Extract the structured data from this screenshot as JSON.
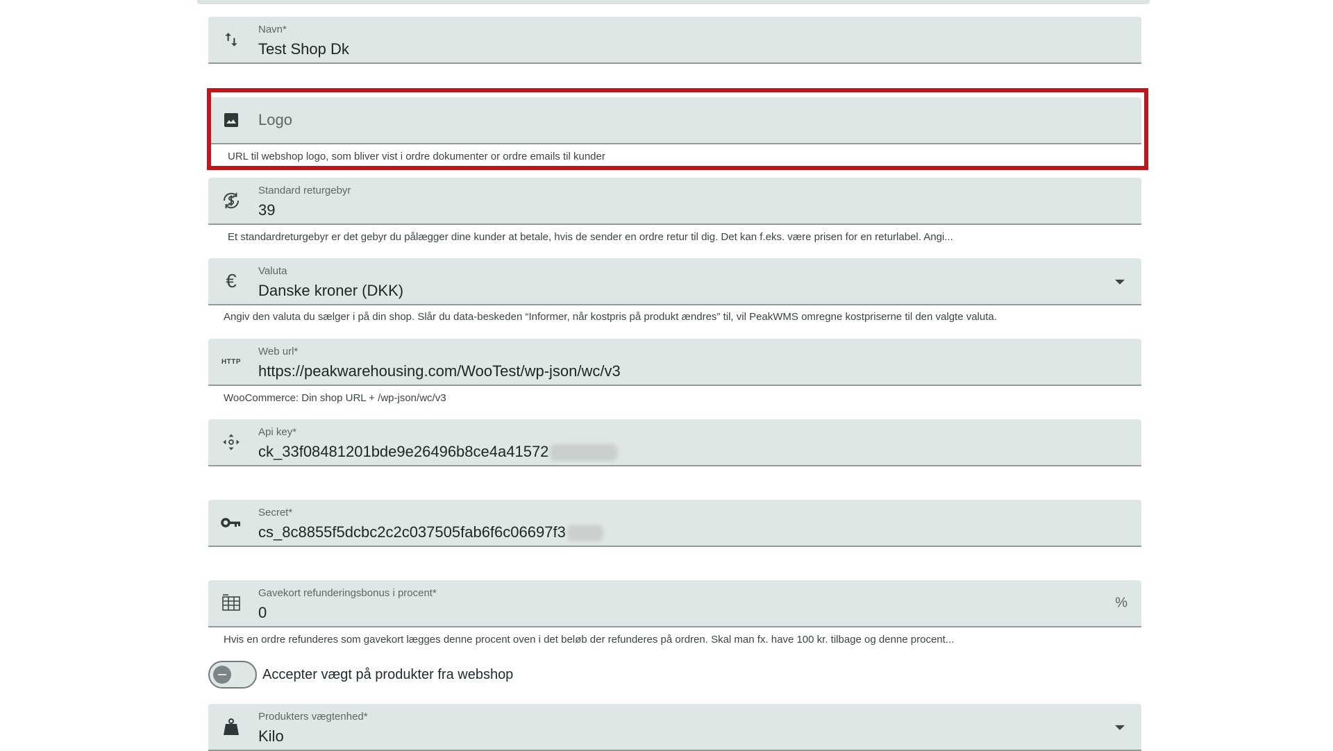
{
  "fields": {
    "navn": {
      "label": "Navn*",
      "value": "Test Shop Dk",
      "icon": "swap-vertical-icon"
    },
    "logo": {
      "placeholder": "Logo",
      "hint": "URL til webshop logo, som bliver vist i ordre dokumenter or ordre emails til kunder",
      "icon": "image-icon"
    },
    "returgebyr": {
      "label": "Standard returgebyr",
      "value": "39",
      "hint": "Et standardreturgebyr er det gebyr du pålægger dine kunder at betale, hvis de sender en ordre retur til dig. Det kan f.eks. være prisen for en returlabel. Angi...",
      "icon": "currency-exchange-icon"
    },
    "valuta": {
      "label": "Valuta",
      "value": "Danske kroner (DKK)",
      "hint": "Angiv den valuta du sælger i på din shop. Slår du data-beskeden “Informer, når kostpris på produkt ændres” til, vil PeakWMS omregne kostpriserne til den valgte valuta.",
      "icon": "euro-icon"
    },
    "weburl": {
      "label": "Web url*",
      "value": "https://peakwarehousing.com/WooTest/wp-json/wc/v3",
      "hint": "WooCommerce: Din shop URL + /wp-json/wc/v3",
      "icon": "http-icon",
      "icon_text": "HTTP"
    },
    "apikey": {
      "label": "Api key*",
      "value": "ck_33f08481201bde9e26496b8ce4a41572",
      "icon": "move-icon"
    },
    "secret": {
      "label": "Secret*",
      "value": "cs_8c8855f5dcbc2c2c037505fab6f6c06697f3",
      "icon": "key-icon"
    },
    "gavekort": {
      "label": "Gavekort refunderingsbonus i procent*",
      "value": "0",
      "suffix": "%",
      "hint": "Hvis en ordre refunderes som gavekort lægges denne procent oven i det beløb der refunderes på ordren. Skal man fx. have 100 kr. tilbage og denne procent...",
      "icon": "table-icon"
    },
    "vaegtenhed": {
      "label": "Produkters vægtenhed*",
      "value": "Kilo",
      "icon": "weight-icon"
    }
  },
  "toggle": {
    "label": "Accepter vægt på produkter fra webshop",
    "checked": false
  },
  "colors": {
    "highlight": "#c0151b",
    "field_bg": "#dfe6e6"
  }
}
